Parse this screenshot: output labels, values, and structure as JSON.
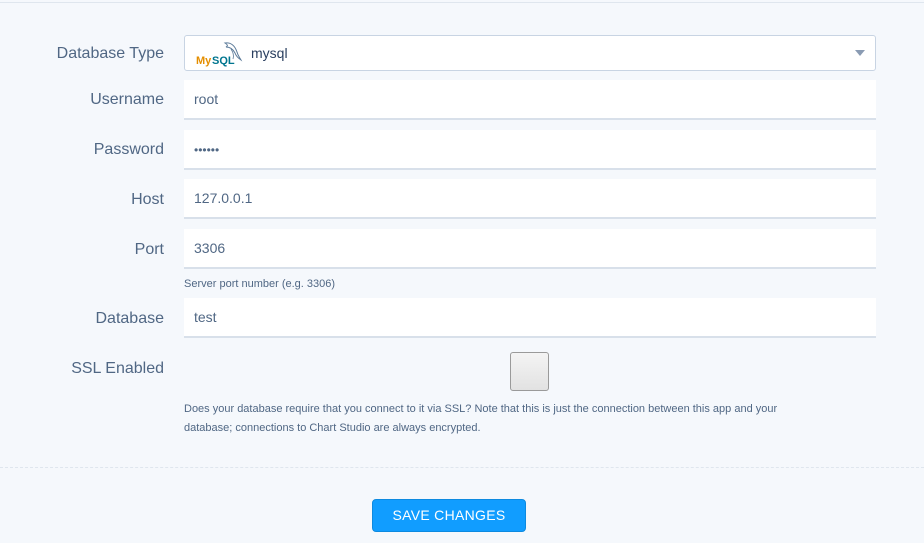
{
  "form": {
    "database_type": {
      "label": "Database Type",
      "selected": "mysql",
      "logo_text": "MySQL",
      "icon": "mysql-dolphin-icon"
    },
    "username": {
      "label": "Username",
      "value": "root"
    },
    "password": {
      "label": "Password",
      "value": "••••••"
    },
    "host": {
      "label": "Host",
      "value": "127.0.0.1"
    },
    "port": {
      "label": "Port",
      "value": "3306",
      "help": "Server port number (e.g. 3306)"
    },
    "database": {
      "label": "Database",
      "value": "test"
    },
    "ssl": {
      "label": "SSL Enabled",
      "checked": false,
      "help_line1": "Does your database require that you connect to it via SSL? Note that this is just the connection between this app and your",
      "help_line2": "database; connections to Chart Studio are always encrypted."
    }
  },
  "actions": {
    "save_label": "SAVE CHANGES"
  },
  "colors": {
    "accent": "#119dff",
    "label": "#506784",
    "background": "#f5f8fc",
    "field_border": "#d8e0ea"
  }
}
